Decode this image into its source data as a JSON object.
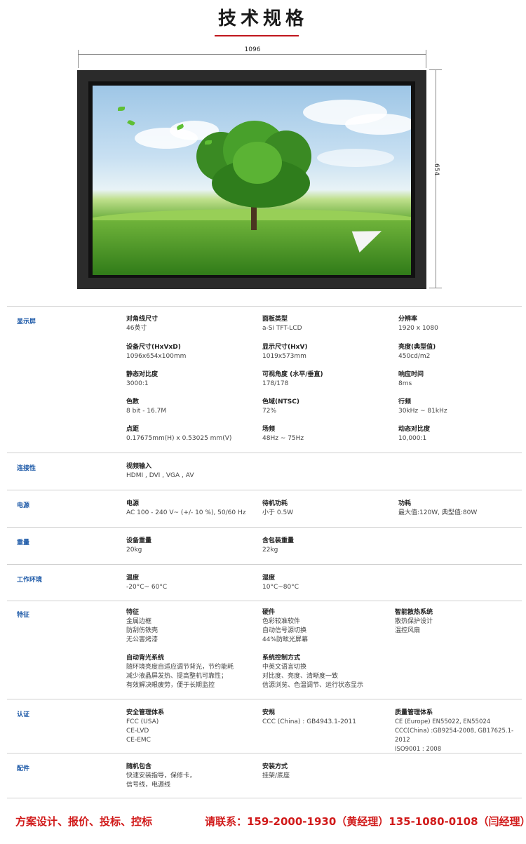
{
  "page": {
    "title": "技术规格"
  },
  "dimensions": {
    "width": "1096",
    "height": "654"
  },
  "sections": [
    {
      "label": "显示屏",
      "items": [
        {
          "name": "对角线尺寸",
          "value": "46英寸"
        },
        {
          "name": "面板类型",
          "value": "a-Si TFT-LCD"
        },
        {
          "name": "分辨率",
          "value": "1920 x 1080"
        },
        {
          "name": "设备尺寸(HxVxD)",
          "value": "1096x654x100mm"
        },
        {
          "name": "显示尺寸(HxV)",
          "value": "1019x573mm"
        },
        {
          "name": "亮度(典型值)",
          "value": "450cd/m2"
        },
        {
          "name": "静态对比度",
          "value": "3000:1"
        },
        {
          "name": "可视角度 (水平/垂直)",
          "value": "178/178"
        },
        {
          "name": "响应时间",
          "value": "8ms"
        },
        {
          "name": "色数",
          "value": "8 bit - 16.7M"
        },
        {
          "name": "色域(NTSC)",
          "value": "72%"
        },
        {
          "name": "行频",
          "value": "30kHz ~ 81kHz"
        },
        {
          "name": "点距",
          "value": "0.17675mm(H) x 0.53025  mm(V)"
        },
        {
          "name": "场频",
          "value": "48Hz ~ 75Hz"
        },
        {
          "name": "动态对比度",
          "value": "10,000:1"
        }
      ]
    },
    {
      "label": "连接性",
      "items": [
        {
          "name": "视频输入",
          "value": "HDMI , DVI , VGA , AV"
        }
      ]
    },
    {
      "label": "电源",
      "items": [
        {
          "name": "电源",
          "value": "AC 100 - 240 V~ (+/- 10 %), 50/60 Hz"
        },
        {
          "name": "待机功耗",
          "value": "小于 0.5W"
        },
        {
          "name": "功耗",
          "value": "最大值:120W, 典型值:80W"
        }
      ]
    },
    {
      "label": "重量",
      "items": [
        {
          "name": "设备重量",
          "value": "20kg"
        },
        {
          "name": "含包装重量",
          "value": "22kg"
        }
      ]
    },
    {
      "label": "工作环境",
      "items": [
        {
          "name": "温度",
          "value": "-20°C~ 60°C"
        },
        {
          "name": "湿度",
          "value": "10°C~80°C"
        }
      ]
    },
    {
      "label": "特征",
      "items": [
        {
          "name": "特征",
          "value": "金属边框\n防刮伤铁壳\n无公害烤漆"
        },
        {
          "name": "硬件",
          "value": "色彩较准软件\n自动信号源切换\n44%防眩光屏幕"
        },
        {
          "name": "智能散热系统",
          "value": "散热保护设计\n温控风扇"
        },
        {
          "name": "自动背光系统",
          "value": "随环境亮度自适应调节背光，节约能耗\n减少液晶屏发热、提高整机可靠性；\n有效解决眼疲劳，便于长期监控"
        },
        {
          "name": "系统控制方式",
          "value": "中英文语言切换\n对比度、亮度、清晰度一致\n信源浏览、色温调节、运行状态显示"
        }
      ]
    },
    {
      "label": "认证",
      "items": [
        {
          "name": "安全管理体系",
          "value": "FCC (USA)\nCE-LVD\nCE-EMC"
        },
        {
          "name": "安规",
          "value": "CCC (China) : GB4943.1-2011"
        },
        {
          "name": "质量管理体系",
          "value": "CE (Europe) EN55022, EN55024\nCCC(China) :GB9254-2008, GB17625.1-2012\nISO9001 : 2008"
        }
      ]
    },
    {
      "label": "配件",
      "items": [
        {
          "name": "随机包含",
          "value": "快速安装指导，保修卡，\n信号线，电源线"
        },
        {
          "name": "安装方式",
          "value": "挂架/底座"
        }
      ]
    }
  ],
  "footer": {
    "left": "方案设计、报价、投标、控标",
    "right": "请联系：159-2000-1930（黄经理）135-1080-0108（闫经理）"
  }
}
